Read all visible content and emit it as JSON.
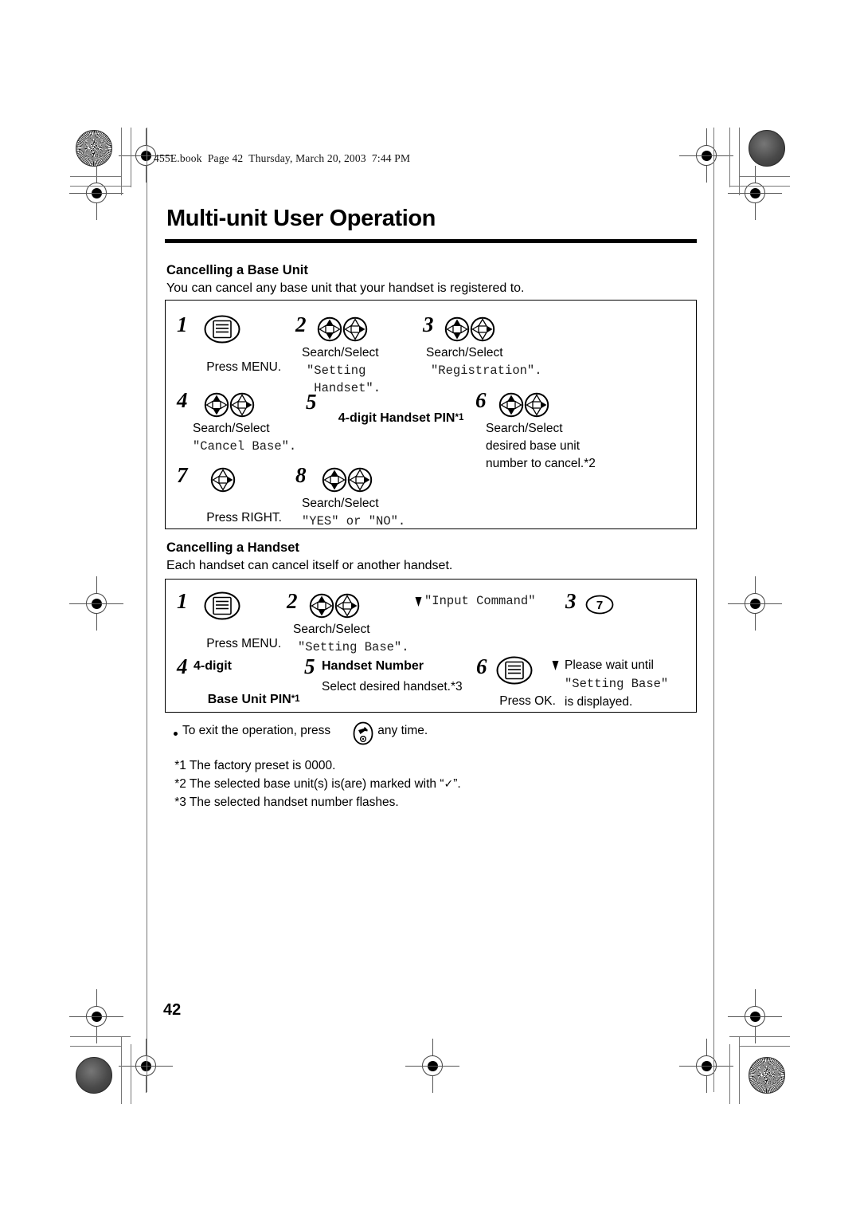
{
  "print_slug": "455E.book  Page 42  Thursday, March 20, 2003  7:44 PM",
  "chapter_title": "Multi-unit User Operation",
  "page_number": "42",
  "sections": [
    {
      "heading": "Cancelling a Base Unit",
      "intro": "You can cancel any base unit that your handset is registered to.",
      "steps": [
        {
          "num": "1",
          "icon": "menu-key-icon",
          "label": "Press ",
          "label_bold": "MENU",
          "label_end": "."
        },
        {
          "num": "2",
          "icon": "navigator-search-select-icon",
          "label": "Search/Select",
          "display": "\"Setting",
          "display2": " Handset\"."
        },
        {
          "num": "3",
          "icon": "navigator-search-select-icon",
          "label": "Search/Select",
          "display": "\"Registration\"."
        },
        {
          "num": "4",
          "icon": "navigator-search-select-icon",
          "label": "Search/Select",
          "display": "\"Cancel Base\"."
        },
        {
          "num": "5",
          "bold_label": "4-digit Handset PIN",
          "footnote_ref": "*1"
        },
        {
          "num": "6",
          "icon": "navigator-search-select-icon",
          "label": "Search/Select",
          "label2": "desired base unit",
          "label3": "number to cancel.*2"
        },
        {
          "num": "7",
          "icon": "navigator-right-icon",
          "label": "Press ",
          "label_bold": "RIGHT",
          "label_end": "."
        },
        {
          "num": "8",
          "icon": "navigator-search-select-icon",
          "label": "Search/Select",
          "display": "\"YES\" or \"NO\"."
        }
      ]
    },
    {
      "heading": "Cancelling a Handset",
      "intro": "Each handset can cancel itself or another handset.",
      "steps": [
        {
          "num": "1",
          "icon": "menu-key-icon",
          "label": "Press ",
          "label_bold": "MENU",
          "label_end": "."
        },
        {
          "num": "2",
          "icon": "navigator-search-select-icon",
          "label": "Search/Select",
          "display": "\"Setting Base\".",
          "result_display": "\"Input Command\""
        },
        {
          "num": "3",
          "icon": "number-key-7-icon",
          "key": "7"
        },
        {
          "num": "4",
          "bold_label": "4-digit",
          "bold_label2": "Base Unit PIN",
          "footnote_ref": "*1"
        },
        {
          "num": "5",
          "bold_label": "Handset Number",
          "label": "Select desired handset.*3"
        },
        {
          "num": "6",
          "icon": "menu-key-icon",
          "label": "Press ",
          "label_bold": "OK",
          "label_end": ".",
          "note1": "Please wait until",
          "note_display": "\"Setting Base\"",
          "note2": "is displayed."
        }
      ]
    }
  ],
  "footnotes": [
    {
      "marker": "bullet",
      "text_before": "To exit the operation, press ",
      "icon": "off-key-icon",
      "text_after": " any time."
    },
    {
      "marker": "*1",
      "text": "The factory preset is 0000."
    },
    {
      "marker": "*2",
      "text_before": "The selected base unit(s) is(are) marked with “",
      "glyph": "✓",
      "text_after": "”."
    },
    {
      "marker": "*3",
      "text": "The selected handset number flashes."
    }
  ]
}
